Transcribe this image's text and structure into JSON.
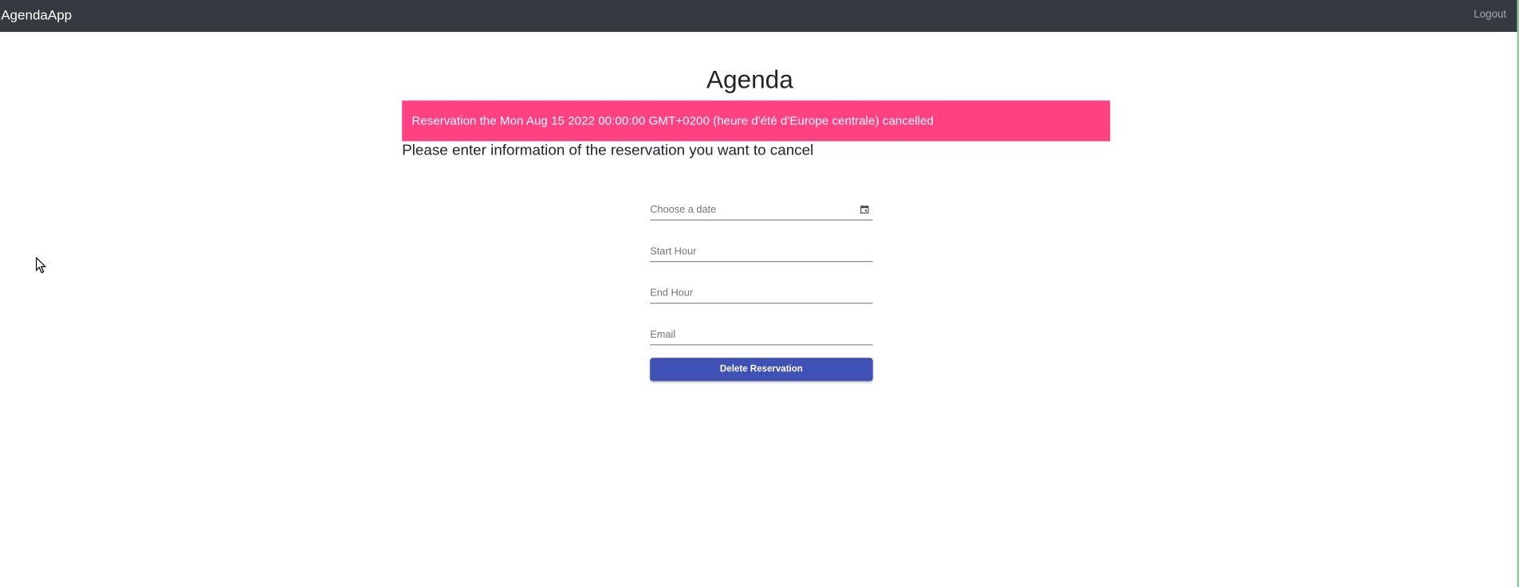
{
  "navbar": {
    "brand": "AgendaApp",
    "logout_label": "Logout"
  },
  "main": {
    "title": "Agenda",
    "alert_message": "Reservation the Mon Aug 15 2022 00:00:00 GMT+0200 (heure d'été d'Europe centrale) cancelled",
    "alert_color": "#ff4081",
    "subtitle": "Please enter information of the reservation you want to cancel"
  },
  "form": {
    "date_placeholder": "Choose a date",
    "start_hour_placeholder": "Start Hour",
    "end_hour_placeholder": "End Hour",
    "email_placeholder": "Email",
    "submit_label": "Delete Reservation",
    "submit_color": "#3f51b5"
  },
  "icons": {
    "date_picker": "calendar-icon",
    "pointer": "mouse-cursor-icon"
  }
}
